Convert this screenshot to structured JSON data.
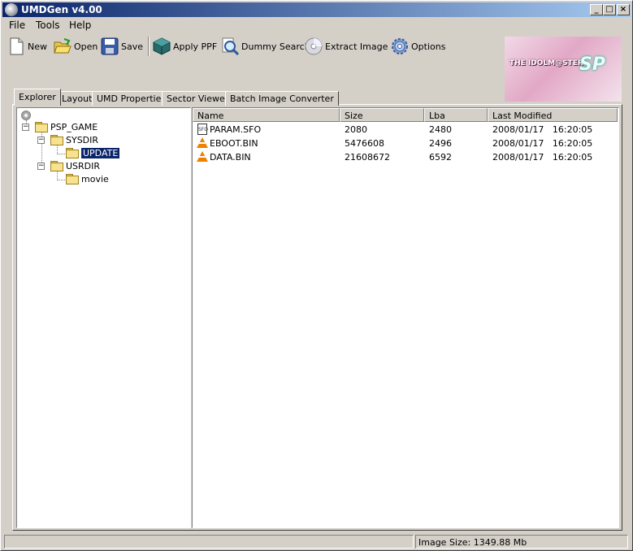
{
  "window": {
    "title": "UMDGen v4.00"
  },
  "menu": {
    "file": "File",
    "tools": "Tools",
    "help": "Help"
  },
  "toolbar": {
    "new": "New",
    "open": "Open",
    "save": "Save",
    "apply_ppf": "Apply PPF",
    "dummy_search": "Dummy Search",
    "extract_image": "Extract Image",
    "options": "Options"
  },
  "banner": {
    "text": "THE IDOLM@STER",
    "sub": "SP"
  },
  "tabs": [
    "Explorer",
    "Layout",
    "UMD Properties",
    "Sector Viewer",
    "Batch Image Converter"
  ],
  "tree": {
    "psp_game": "PSP_GAME",
    "sysdir": "SYSDIR",
    "update": "UPDATE",
    "usrdir": "USRDIR",
    "movie": "movie"
  },
  "list": {
    "columns": [
      "Name",
      "Size",
      "Lba",
      "Last Modified"
    ],
    "rows": [
      {
        "name": "PARAM.SFO",
        "size": "2080",
        "lba": "2480",
        "modified": "2008/01/17   16:20:05"
      },
      {
        "name": "EBOOT.BIN",
        "size": "5476608",
        "lba": "2496",
        "modified": "2008/01/17   16:20:05"
      },
      {
        "name": "DATA.BIN",
        "size": "21608672",
        "lba": "6592",
        "modified": "2008/01/17   16:20:05"
      }
    ]
  },
  "status": {
    "left": "",
    "image_size": "Image Size: 1349.88 Mb"
  }
}
